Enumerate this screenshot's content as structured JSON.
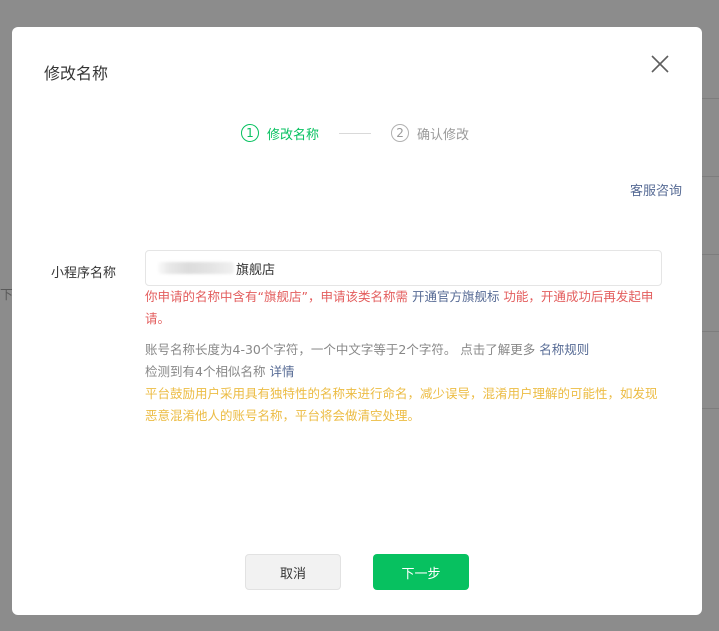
{
  "background": {
    "side_text": "下"
  },
  "dialog": {
    "title": "修改名称",
    "close_icon": "close-icon"
  },
  "steps": [
    {
      "num": "1",
      "label": "修改名称",
      "state": "active"
    },
    {
      "num": "2",
      "label": "确认修改",
      "state": "inactive"
    }
  ],
  "service_link": "客服咨询",
  "form": {
    "label": "小程序名称",
    "value_suffix": "旗舰店"
  },
  "error": {
    "part1": "你申请的名称中含有“旗舰店”，申请该类名称需 ",
    "link": "开通官方旗舰标",
    "part2": " 功能，开通成功后再发起申请。"
  },
  "info": {
    "line1": "账号名称长度为4-30个字符，一个中文字等于2个字符。 点击了解更多 ",
    "rules_link": "名称规则",
    "line2": "检测到有4个相似名称 ",
    "detail_link": "详情"
  },
  "warning": "平台鼓励用户采用具有独特性的名称来进行命名，减少误导，混淆用户理解的可能性，如发现恶意混淆他人的账号名称，平台将会做清空处理。",
  "buttons": {
    "cancel": "取消",
    "next": "下一步"
  },
  "colors": {
    "accent": "#07c160",
    "error": "#e35d5d",
    "link": "#576b95",
    "warning": "#ecbc44"
  }
}
